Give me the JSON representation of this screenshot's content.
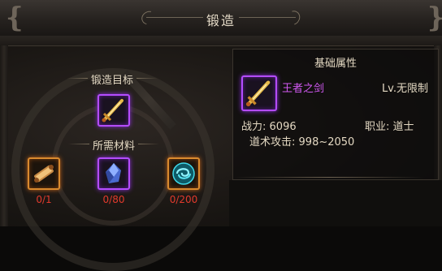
{
  "window": {
    "title": "锻造"
  },
  "forge": {
    "target_label": "锻造目标",
    "materials_label": "所需材料",
    "materials": [
      {
        "icon": "scroll-item-icon",
        "count": "0/1",
        "quality": "orange"
      },
      {
        "icon": "crystal-ore-item-icon",
        "count": "0/80",
        "quality": "purple"
      },
      {
        "icon": "swirl-orb-item-icon",
        "count": "0/200",
        "quality": "orange"
      }
    ]
  },
  "attributes": {
    "title": "基础属性",
    "item_name": "王者之剑",
    "level": "Lv.无限制",
    "power_label": "战力:",
    "power_value": "6096",
    "job_label": "职业:",
    "job_value": "道士",
    "attack_label": "道术攻击:",
    "attack_value": "998~2050"
  },
  "colors": {
    "item_name": "#d159f2",
    "count_insufficient": "#e23a2c",
    "purple_quality": "#b44cff",
    "orange_quality": "#d98a2e"
  }
}
